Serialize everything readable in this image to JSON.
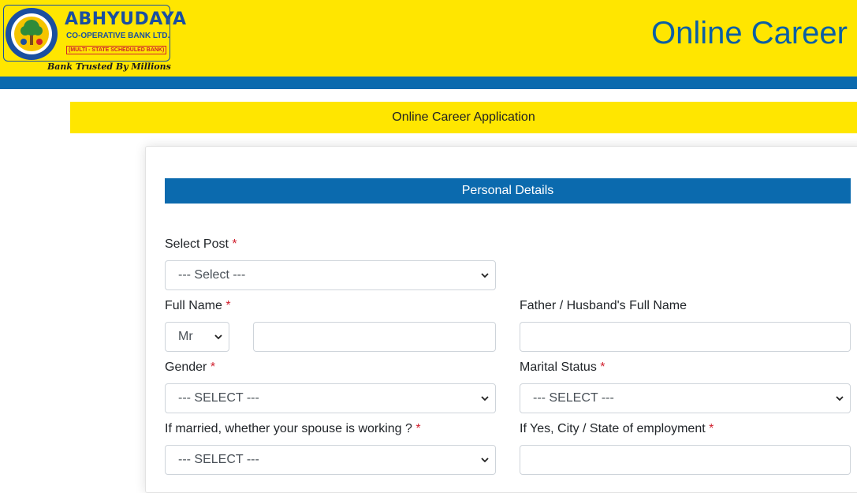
{
  "header": {
    "logo": {
      "name": "ABHYUDAYA",
      "line1": "CO-OPERATIVE BANK LTD.",
      "line2": "(MULTI - STATE SCHEDULED BANK)",
      "tagline": "Bank Trusted By Millions"
    },
    "title": "Online Career"
  },
  "banner": {
    "title": "Online Career Application"
  },
  "section": {
    "title": "Personal Details"
  },
  "form": {
    "required_mark": "*",
    "select_post": {
      "label": "Select Post",
      "value": "--- Select ---"
    },
    "full_name": {
      "label": "Full Name",
      "title_value": "Mr",
      "name_value": ""
    },
    "father_name": {
      "label": "Father / Husband's Full Name",
      "value": ""
    },
    "gender": {
      "label": "Gender",
      "value": "--- SELECT ---"
    },
    "marital_status": {
      "label": "Marital Status",
      "value": "--- SELECT ---"
    },
    "spouse_working": {
      "label": "If married, whether your spouse is working ?",
      "value": "--- SELECT ---"
    },
    "employment_location": {
      "label": "If Yes, City / State of employment",
      "value": ""
    }
  },
  "colors": {
    "header_yellow": "#ffe600",
    "brand_blue": "#0b6aae",
    "required_red": "#d0202e"
  }
}
